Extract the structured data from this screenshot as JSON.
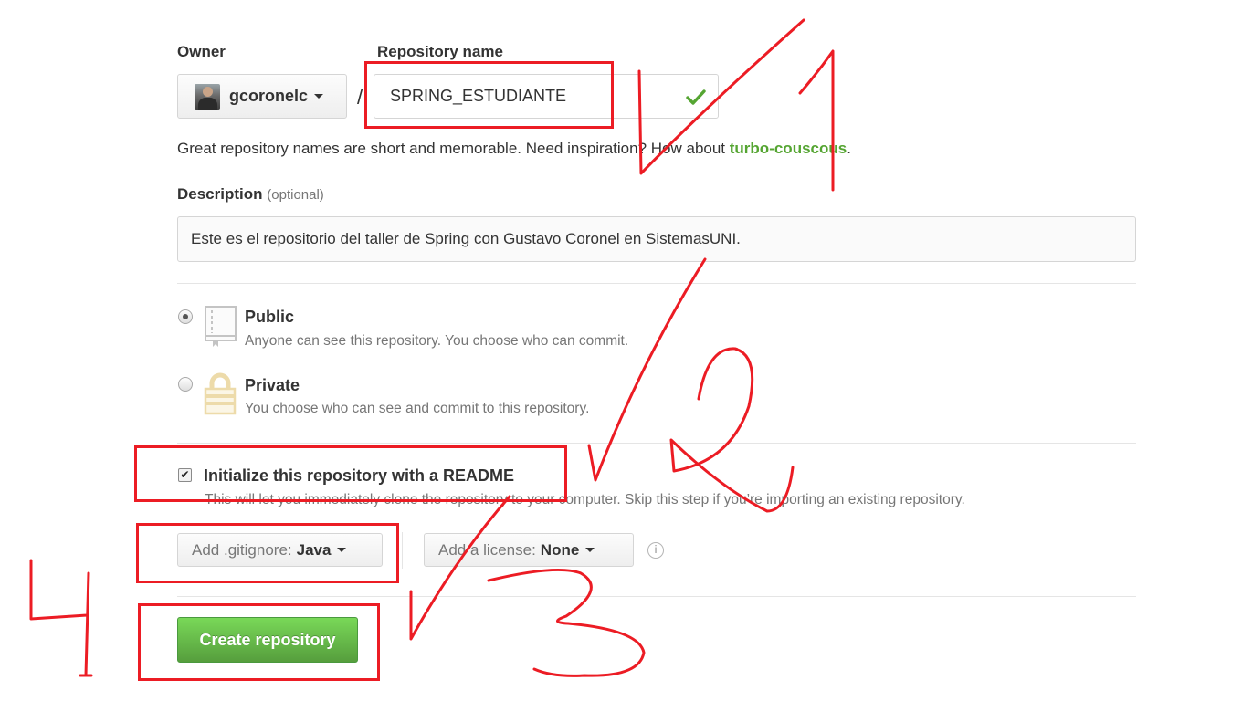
{
  "owner": {
    "label": "Owner",
    "username": "gcoronelc"
  },
  "repo_name": {
    "label": "Repository name",
    "value": "SPRING_ESTUDIANTE",
    "separator": "/"
  },
  "hint": {
    "text": "Great repository names are short and memorable. Need inspiration? How about ",
    "suggestion": "turbo-couscous",
    "end": "."
  },
  "description": {
    "label": "Description",
    "optional": "(optional)",
    "value": "Este es el repositorio del taller de Spring con Gustavo Coronel en SistemasUNI."
  },
  "visibility": {
    "public": {
      "title": "Public",
      "desc": "Anyone can see this repository. You choose who can commit.",
      "selected": true
    },
    "private": {
      "title": "Private",
      "desc": "You choose who can see and commit to this repository.",
      "selected": false
    }
  },
  "readme": {
    "label": "Initialize this repository with a README",
    "desc": "This will let you immediately clone the repository to your computer. Skip this step if you’re importing an existing repository.",
    "checked": true
  },
  "gitignore": {
    "prefix": "Add .gitignore:",
    "value": "Java"
  },
  "license": {
    "prefix": "Add a license:",
    "value": "None"
  },
  "create_button": "Create repository",
  "annotation_color": "#ec1c24",
  "icons": [
    "checkmark-icon",
    "repo-book-icon",
    "lock-icon",
    "info-icon",
    "caret-down-icon"
  ],
  "handwritten_numbers": [
    "1",
    "2",
    "3",
    "4"
  ]
}
